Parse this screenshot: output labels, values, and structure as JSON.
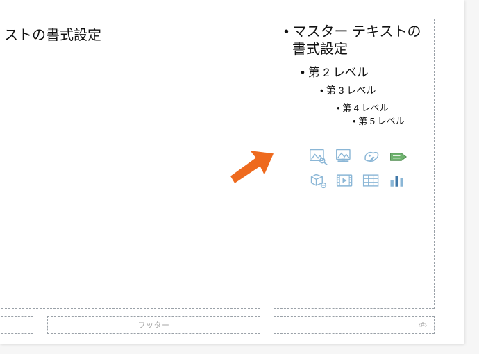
{
  "left_placeholder": {
    "title_partial": "ストの書式設定"
  },
  "right_placeholder": {
    "level1": "マスター テキストの書式設定",
    "level2": "第 2 レベル",
    "level3": "第 3 レベル",
    "level4": "第 4 レベル",
    "level5": "第 5 レベル"
  },
  "icons": {
    "stock": "stock-images-icon",
    "pictures": "pictures-icon",
    "online": "online-pictures-icon",
    "cameo": "cameo-icon",
    "threeD": "3d-model-icon",
    "video": "video-icon",
    "table": "table-icon",
    "chart": "chart-icon"
  },
  "footer": {
    "center": "フッター",
    "page": "‹#›"
  }
}
